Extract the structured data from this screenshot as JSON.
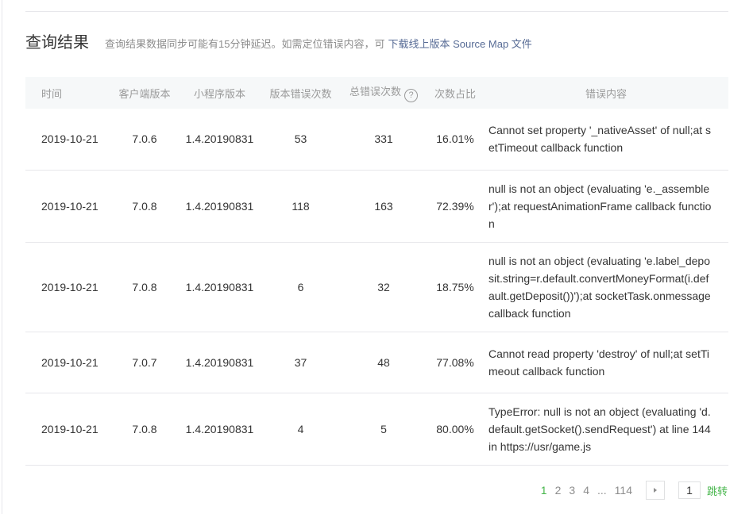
{
  "section": {
    "title": "查询结果",
    "note": "查询结果数据同步可能有15分钟延迟。如需定位错误内容，可",
    "download_link": "下载线上版本 Source Map 文件"
  },
  "table": {
    "headers": {
      "date": "时间",
      "client_version": "客户端版本",
      "app_version": "小程序版本",
      "version_errors": "版本错误次数",
      "total_errors": "总错误次数",
      "ratio": "次数占比",
      "message": "错误内容"
    },
    "help_icon": "question-circle-icon",
    "help_glyph": "?",
    "rows": [
      {
        "date": "2019-10-21",
        "client_version": "7.0.6",
        "app_version": "1.4.20190831",
        "version_errors": "53",
        "total_errors": "331",
        "ratio": "16.01%",
        "message": "Cannot set property '_nativeAsset' of null;at setTimeout callback function"
      },
      {
        "date": "2019-10-21",
        "client_version": "7.0.8",
        "app_version": "1.4.20190831",
        "version_errors": "118",
        "total_errors": "163",
        "ratio": "72.39%",
        "message": "null is not an object (evaluating 'e._assembler');at requestAnimationFrame callback function"
      },
      {
        "date": "2019-10-21",
        "client_version": "7.0.8",
        "app_version": "1.4.20190831",
        "version_errors": "6",
        "total_errors": "32",
        "ratio": "18.75%",
        "message": "null is not an object (evaluating 'e.label_deposit.string=r.default.convertMoneyFormat(i.default.getDeposit())');at socketTask.onmessage callback function"
      },
      {
        "date": "2019-10-21",
        "client_version": "7.0.7",
        "app_version": "1.4.20190831",
        "version_errors": "37",
        "total_errors": "48",
        "ratio": "77.08%",
        "message": "Cannot read property 'destroy' of null;at setTimeout callback function"
      },
      {
        "date": "2019-10-21",
        "client_version": "7.0.8",
        "app_version": "1.4.20190831",
        "version_errors": "4",
        "total_errors": "5",
        "ratio": "80.00%",
        "message": "TypeError: null is not an object (evaluating 'd.default.getSocket().sendRequest') at line 144 in https://usr/game.js"
      }
    ]
  },
  "pagination": {
    "pages": [
      "1",
      "2",
      "3",
      "4"
    ],
    "active": "1",
    "ellipsis": "...",
    "last_page": "114",
    "next_icon": "caret-right-icon",
    "jump_value": "1",
    "jump_label": "跳转"
  },
  "colors": {
    "accent_green": "#44b549",
    "link_blue": "#576b95",
    "header_bg": "#f6f8f9",
    "border": "#e7e7eb"
  }
}
